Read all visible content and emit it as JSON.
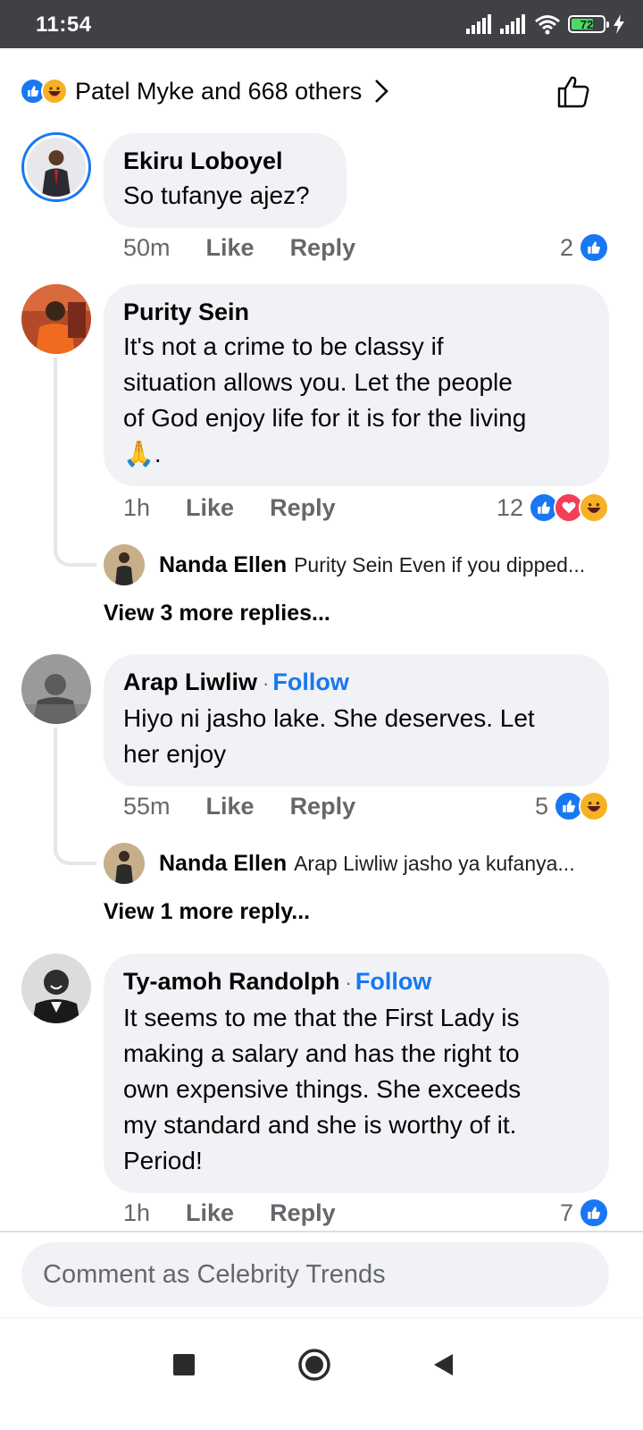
{
  "status_bar": {
    "time": "11:54",
    "battery": "72",
    "battery_level": 0.72
  },
  "reactions_header": {
    "names": "Patel Myke and 668 others"
  },
  "comments": [
    {
      "author": "Ekiru Loboyel",
      "text": "So tufanye ajez?",
      "time": "50m",
      "like_label": "Like",
      "reply_label": "Reply",
      "reaction_count": "2",
      "reactions": [
        "like-icon"
      ]
    },
    {
      "author": "Purity Sein",
      "text_lines": [
        "It's not a crime to be classy if",
        "situation allows you. Let the people",
        "of God enjoy life for it is for the living",
        "🙏."
      ],
      "time": "1h",
      "like_label": "Like",
      "reply_label": "Reply",
      "reaction_count": "12",
      "reactions": [
        "like-icon",
        "love-icon",
        "haha-icon"
      ],
      "reply_preview": {
        "author": "Nanda Ellen",
        "text": "Purity Sein Even if you dipped..."
      },
      "more_replies": "View 3 more replies..."
    },
    {
      "author": "Arap Liwliw",
      "follow_label": "Follow",
      "text_lines": [
        "Hiyo ni jasho lake. She deserves.  Let",
        "her enjoy"
      ],
      "time": "55m",
      "like_label": "Like",
      "reply_label": "Reply",
      "reaction_count": "5",
      "reactions": [
        "like-icon",
        "haha-icon"
      ],
      "reply_preview": {
        "author": "Nanda Ellen",
        "text": "Arap Liwliw jasho ya kufanya..."
      },
      "more_replies": "View 1 more reply..."
    },
    {
      "author": "Ty-amoh Randolph",
      "follow_label": "Follow",
      "text_lines": [
        "It seems to me that the First Lady is",
        "making a salary and has the right to",
        "own expensive things. She exceeds",
        "my standard and she is worthy of it.",
        "Period!"
      ],
      "time": "1h",
      "like_label": "Like",
      "reply_label": "Reply",
      "reaction_count": "7",
      "reactions": [
        "like-icon"
      ]
    }
  ],
  "composer": {
    "placeholder": "Comment as Celebrity Trends"
  },
  "nav_bar": {
    "buttons": [
      "recents-square-icon",
      "home-circle-icon",
      "back-triangle-icon"
    ]
  },
  "colors": {
    "accent": "#1877f2",
    "bubble": "#f0f2f5",
    "status_bar": "#3f4145",
    "muted_text": "#65676b"
  }
}
